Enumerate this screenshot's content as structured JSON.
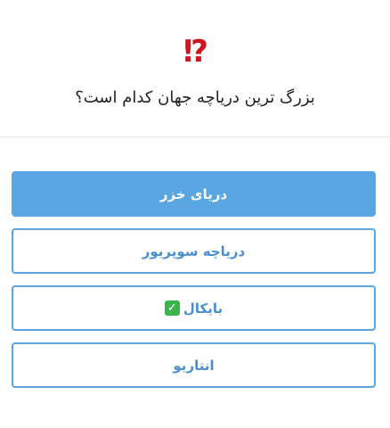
{
  "quiz": {
    "emoji": "⁉",
    "question": "بزرگ ترین دریاچه جهان کدام است؟",
    "options": [
      {
        "label": "دریای خزر",
        "selected": true
      },
      {
        "label": "دریاچه سوپریور",
        "selected": false
      },
      {
        "label": "بایکال",
        "selected": false,
        "badge": "✓"
      },
      {
        "label": "انتاریو",
        "selected": false
      }
    ]
  },
  "colors": {
    "accent": "#5aa6e3",
    "accent_text": "#4a8fcf",
    "emoji_red": "#d0161d",
    "check_green": "#3bb54a"
  }
}
